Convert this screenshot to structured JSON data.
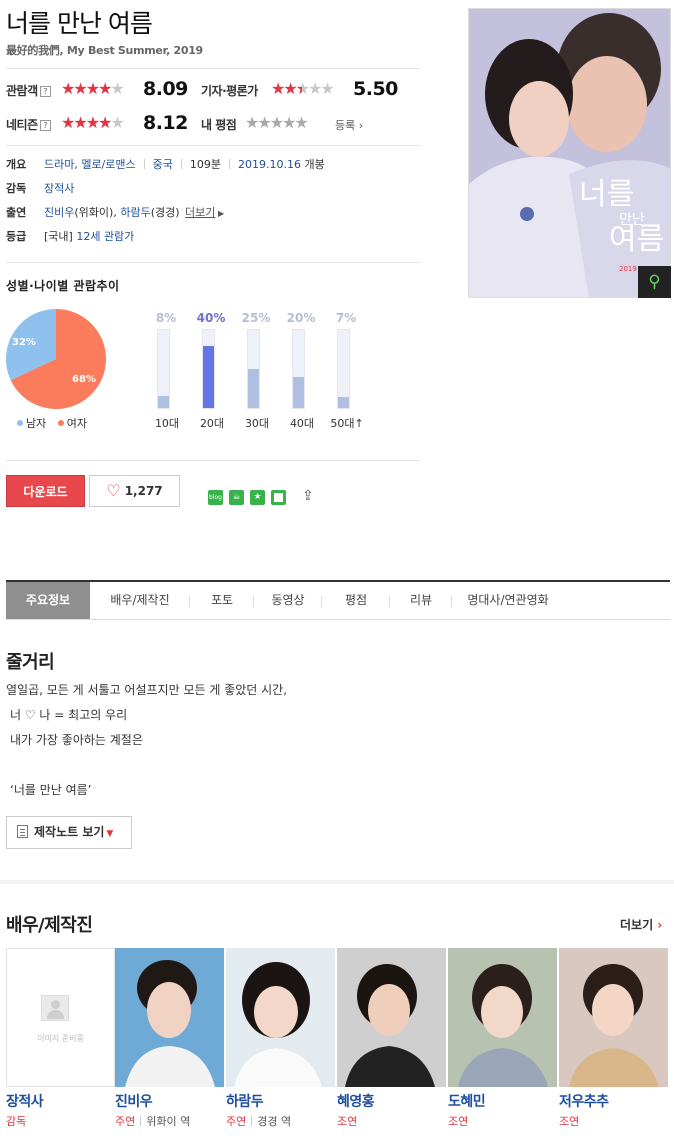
{
  "header": {
    "title": "너를 만난 여름",
    "subtitle": "最好的我們, My Best Summer, 2019"
  },
  "ratings": {
    "audience": {
      "label": "관람객",
      "help": "?",
      "score": "8.09",
      "stars": 4
    },
    "critic": {
      "label": "기자·평론가",
      "score": "5.50",
      "stars": 2.5
    },
    "netizen": {
      "label": "네티즌",
      "help": "?",
      "score": "8.12",
      "stars": 4
    },
    "mine": {
      "label": "내 평점",
      "register": "등록"
    }
  },
  "info": {
    "overview_key": "개요",
    "genre": "드라마, 멜로/로맨스",
    "country": "중국",
    "runtime": "109분",
    "release": "2019.10.16",
    "release_suffix": "개봉",
    "director_key": "감독",
    "director": "장적사",
    "cast_key": "출연",
    "cast1": "진비우",
    "cast1_role": "(위화이),",
    "cast2": "하람두",
    "cast2_role": "(경경)",
    "more_cast": "더보기",
    "rating_key": "등급",
    "rating_prefix": "[국내]",
    "rating_value": "12세 관람가"
  },
  "poster": {
    "alt_title": "너를 만난 여름",
    "year": "2019"
  },
  "trend": {
    "title": "성별·나이별 관람추이",
    "male_pct": "32%",
    "female_pct": "68%",
    "male_label": "남자",
    "female_label": "여자",
    "colors": {
      "male": "#8ec1ee",
      "female": "#fb7c5c"
    },
    "age_pcts": [
      "8%",
      "40%",
      "25%",
      "20%",
      "7%"
    ],
    "age_labels": [
      "10대",
      "20대",
      "30대",
      "40대",
      "50대↑"
    ],
    "age_values": [
      8,
      40,
      25,
      20,
      7
    ]
  },
  "actions": {
    "download": "다운로드",
    "likes": "1,277",
    "share_icons": [
      "blog",
      "cafe",
      "star",
      "square",
      "share"
    ]
  },
  "tabs": [
    "주요정보",
    "배우/제작진",
    "포토",
    "동영상",
    "평점",
    "리뷰",
    "명대사/연관영화"
  ],
  "synopsis": {
    "title": "줄거리",
    "lines": [
      "열일곱, 모든 게 서툴고 어설프지만 모든 게 좋았던 시간,",
      "너 ♡ 나 = 최고의 우리",
      "내가 가장 좋아하는 계절은",
      "‘너를 만난 여름’"
    ],
    "note_button": "제작노트 보기"
  },
  "cast_section": {
    "title": "배우/제작진",
    "more": "더보기",
    "no_image": "이미지 준비중",
    "people": [
      {
        "name": "장적사",
        "role": "감독",
        "character": ""
      },
      {
        "name": "진비우",
        "role": "주연",
        "character": "위화이 역"
      },
      {
        "name": "하람두",
        "role": "주연",
        "character": "경경 역"
      },
      {
        "name": "혜영홍",
        "role": "조연",
        "character": ""
      },
      {
        "name": "도혜민",
        "role": "조연",
        "character": ""
      },
      {
        "name": "저우추추",
        "role": "조연",
        "character": ""
      }
    ]
  }
}
